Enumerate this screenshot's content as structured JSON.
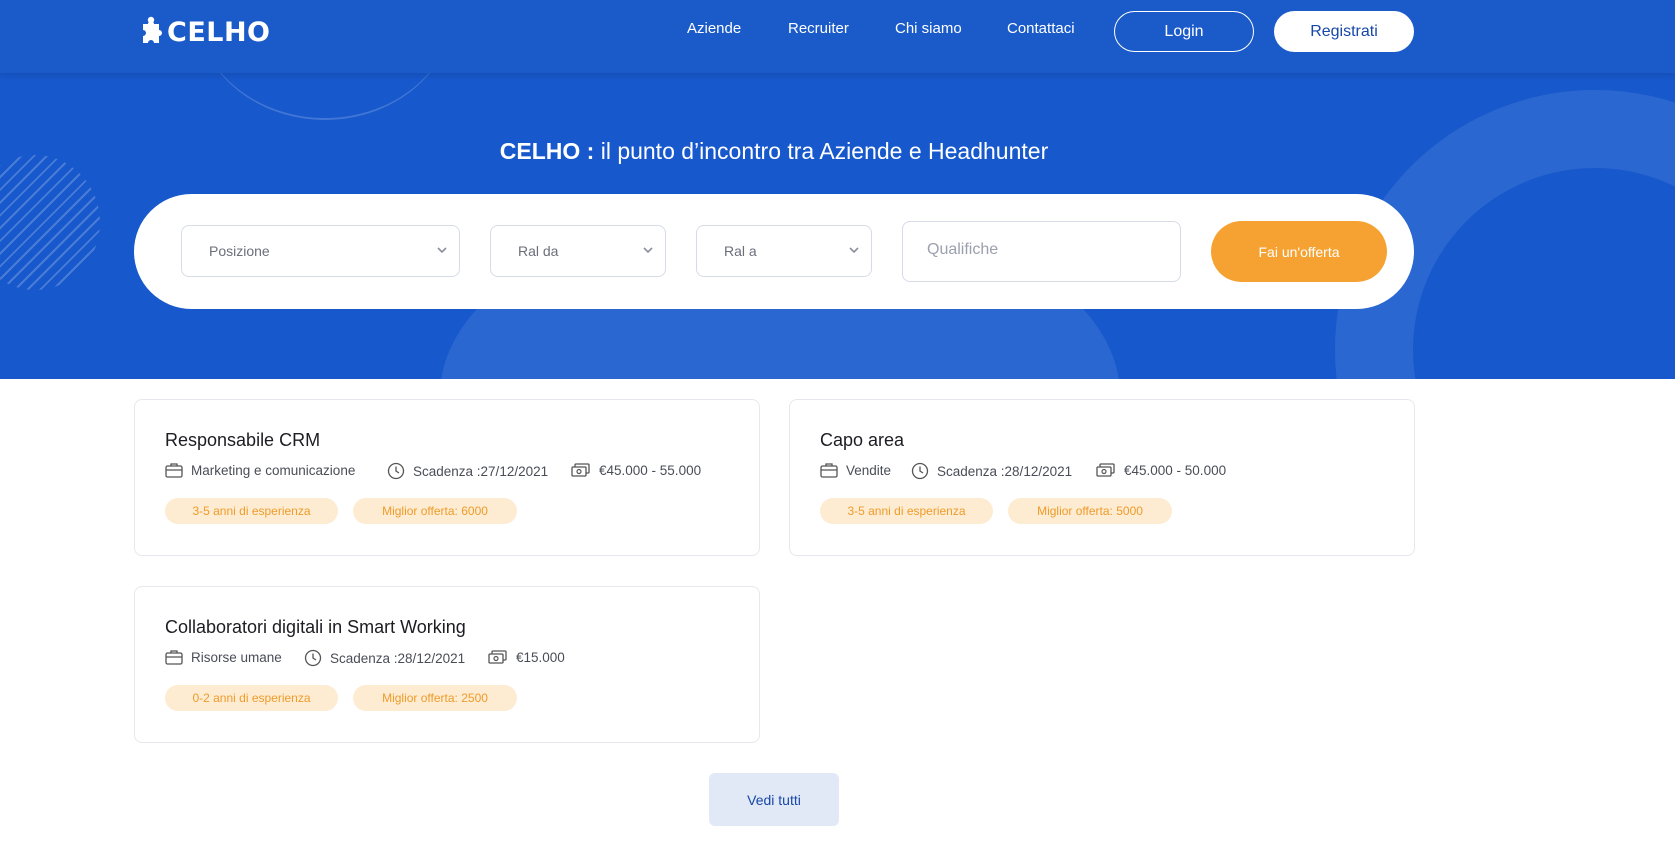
{
  "header": {
    "logo_text": "CELHO",
    "nav": [
      "Aziende",
      "Recruiter",
      "Chi siamo",
      "Contattaci"
    ],
    "login_label": "Login",
    "register_label": "Registrati"
  },
  "hero": {
    "title_brand": "CELHO :",
    "title_rest": " il punto d’incontro tra Aziende e Headhunter"
  },
  "search": {
    "position_placeholder": "Posizione",
    "ral_from_placeholder": "Ral da",
    "ral_to_placeholder": "Ral a",
    "qualifications_placeholder": "Qualifiche",
    "submit_label": "Fai un'offerta"
  },
  "jobs": [
    {
      "title": "Responsabile CRM",
      "category": "Marketing e comunicazione",
      "deadline": "Scadenza :27/12/2021",
      "salary": "€45.000 - 55.000",
      "experience": "3-5 anni di esperienza",
      "best_offer": "Miglior offerta: 6000"
    },
    {
      "title": "Capo area",
      "category": "Vendite",
      "deadline": "Scadenza :28/12/2021",
      "salary": "€45.000 - 50.000",
      "experience": "3-5 anni di esperienza",
      "best_offer": "Miglior offerta: 5000"
    },
    {
      "title": "Collaboratori digitali in Smart Working",
      "category": "Risorse umane",
      "deadline": "Scadenza :28/12/2021",
      "salary": "€15.000",
      "experience": "0-2 anni di esperienza",
      "best_offer": "Miglior offerta: 2500"
    }
  ],
  "see_all_label": "Vedi tutti",
  "colors": {
    "primary_blue": "#1758cc",
    "accent_orange": "#f6a233",
    "badge_bg": "#fdecd2",
    "badge_text": "#ef9b2a"
  }
}
